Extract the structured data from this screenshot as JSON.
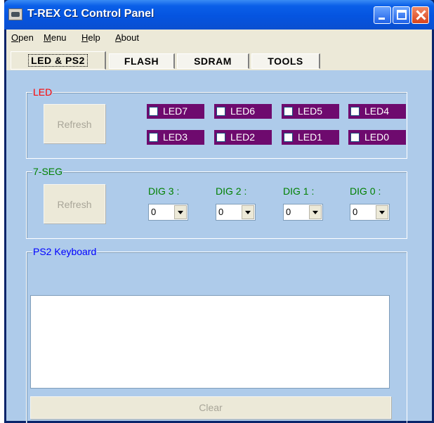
{
  "window": {
    "title": "T-REX C1 Control Panel"
  },
  "menu": [
    "Open",
    "Menu",
    "Help",
    "About"
  ],
  "tabs": [
    "LED & PS2",
    "FLASH",
    "SDRAM",
    "TOOLS"
  ],
  "led_group": {
    "label": "LED",
    "refresh_label": "Refresh",
    "leds": [
      {
        "label": "LED7",
        "checked": false
      },
      {
        "label": "LED6",
        "checked": false
      },
      {
        "label": "LED5",
        "checked": false
      },
      {
        "label": "LED4",
        "checked": false
      },
      {
        "label": "LED3",
        "checked": false
      },
      {
        "label": "LED2",
        "checked": false
      },
      {
        "label": "LED1",
        "checked": false
      },
      {
        "label": "LED0",
        "checked": false
      }
    ]
  },
  "seg_group": {
    "label": "7-SEG",
    "refresh_label": "Refresh",
    "digits": [
      {
        "label": "DIG 3 :",
        "value": "0"
      },
      {
        "label": "DIG 2 :",
        "value": "0"
      },
      {
        "label": "DIG 1 :",
        "value": "0"
      },
      {
        "label": "DIG 0 :",
        "value": "0"
      }
    ]
  },
  "ps2_group": {
    "label": "PS2 Keyboard",
    "text": "",
    "clear_label": "Clear"
  },
  "colors": {
    "panel_bg": "#aecbea",
    "led_bg": "#6e0a6e",
    "led_label": "#ff0000",
    "seg_label": "#008000",
    "ps2_label": "#0000ff"
  }
}
